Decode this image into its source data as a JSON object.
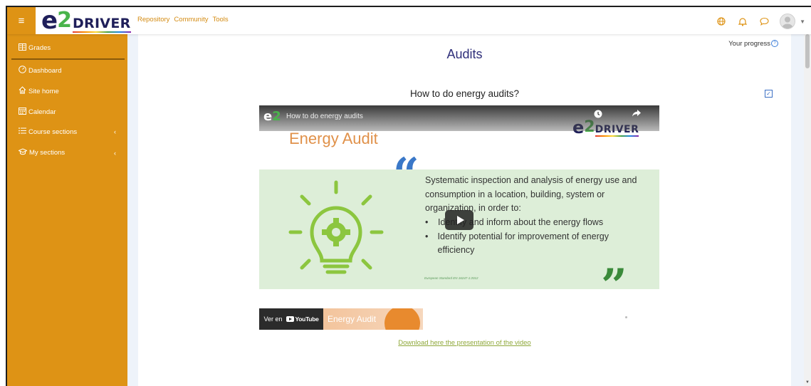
{
  "topbar": {
    "menu_icon": "hamburger-icon",
    "logo": {
      "e": "e",
      "two": "2",
      "driver": "DRIVER"
    },
    "nav_links": [
      "Repository",
      "Community",
      "Tools"
    ],
    "icons": [
      "globe-icon",
      "bell-icon",
      "chat-icon",
      "user-avatar-icon",
      "chevron-down-icon"
    ]
  },
  "sidebar": {
    "accent": "#de9315",
    "items": [
      {
        "label": "Grades",
        "icon": "grades-icon"
      },
      {
        "label": "Dashboard",
        "icon": "dashboard-icon"
      },
      {
        "label": "Site home",
        "icon": "home-icon"
      },
      {
        "label": "Calendar",
        "icon": "calendar-icon"
      },
      {
        "label": "Course sections",
        "icon": "list-icon",
        "arrow": "‹"
      },
      {
        "label": "My sections",
        "icon": "graduation-cap-icon",
        "arrow": "‹"
      }
    ]
  },
  "main": {
    "progress_label": "Your progress",
    "page_title": "Audits",
    "section_title": "How to do energy audits?",
    "download_link": "Download here the presentation of the video"
  },
  "video": {
    "title": "How to do energy audits",
    "heading": "Energy Audit",
    "logo": {
      "e": "e",
      "two": "2",
      "driver": "DRIVER"
    },
    "text": "Systematic inspection and analysis of energy use and consumption in a location, building, system or organization, in order to:",
    "bullets": [
      "Identify and inform about the energy flows",
      "Identify potential for improvement of energy efficiency"
    ],
    "reference": "European Standard EN 16247-1:2012",
    "watch_on": "Ver en",
    "youtube": "YouTube",
    "thumbnail_label": "Energy Audit"
  }
}
